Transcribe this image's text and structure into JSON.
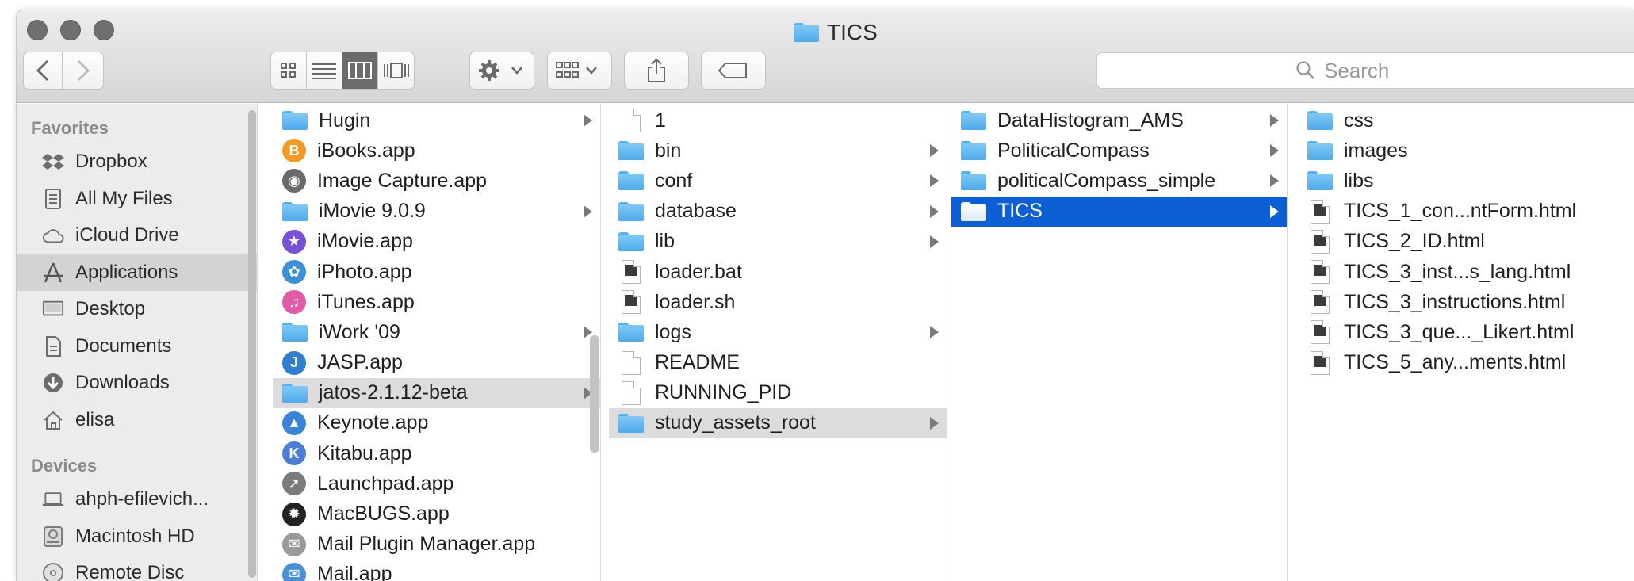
{
  "window": {
    "title": "TICS"
  },
  "toolbar": {
    "back_icon": "chevron-left-icon",
    "forward_icon": "chevron-right-icon",
    "view_icons": [
      "icon-view-icon",
      "list-view-icon",
      "column-view-icon",
      "cover-flow-icon"
    ],
    "action_icon": "gear-icon",
    "arrange_icon": "arrange-icon",
    "share_icon": "share-icon",
    "tag_icon": "tag-icon",
    "search_placeholder": "Search"
  },
  "sidebar": {
    "favorites_heading": "Favorites",
    "favorites": [
      {
        "label": "Dropbox",
        "icon": "dropbox-icon"
      },
      {
        "label": "All My Files",
        "icon": "all-files-icon"
      },
      {
        "label": "iCloud Drive",
        "icon": "cloud-icon"
      },
      {
        "label": "Applications",
        "icon": "applications-icon"
      },
      {
        "label": "Desktop",
        "icon": "desktop-icon"
      },
      {
        "label": "Documents",
        "icon": "documents-icon"
      },
      {
        "label": "Downloads",
        "icon": "downloads-icon"
      },
      {
        "label": "elisa",
        "icon": "home-icon"
      }
    ],
    "devices_heading": "Devices",
    "devices": [
      {
        "label": "ahph-efilevich...",
        "icon": "laptop-icon"
      },
      {
        "label": "Macintosh HD",
        "icon": "disk-icon"
      },
      {
        "label": "Remote Disc",
        "icon": "disc-icon"
      }
    ]
  },
  "columns": {
    "applications": [
      {
        "label": "Hugin",
        "icon": "folder",
        "chevron": true
      },
      {
        "label": "iBooks.app",
        "icon": "ibooks",
        "chevron": false
      },
      {
        "label": "Image Capture.app",
        "icon": "imagecapture",
        "chevron": false
      },
      {
        "label": "iMovie 9.0.9",
        "icon": "folder",
        "chevron": true
      },
      {
        "label": "iMovie.app",
        "icon": "imovie",
        "chevron": false
      },
      {
        "label": "iPhoto.app",
        "icon": "iphoto",
        "chevron": false
      },
      {
        "label": "iTunes.app",
        "icon": "itunes",
        "chevron": false
      },
      {
        "label": "iWork '09",
        "icon": "folder",
        "chevron": true
      },
      {
        "label": "JASP.app",
        "icon": "jasp",
        "chevron": false
      },
      {
        "label": "jatos-2.1.12-beta",
        "icon": "folder",
        "chevron": true
      },
      {
        "label": "Keynote.app",
        "icon": "keynote",
        "chevron": false
      },
      {
        "label": "Kitabu.app",
        "icon": "kitabu",
        "chevron": false
      },
      {
        "label": "Launchpad.app",
        "icon": "launchpad",
        "chevron": false
      },
      {
        "label": "MacBUGS.app",
        "icon": "macbugs",
        "chevron": false
      },
      {
        "label": "Mail Plugin Manager.app",
        "icon": "mailplugin",
        "chevron": false
      },
      {
        "label": "Mail.app",
        "icon": "mail",
        "chevron": false
      }
    ],
    "jatos": [
      {
        "label": "1",
        "icon": "doc",
        "chevron": false
      },
      {
        "label": "bin",
        "icon": "folder",
        "chevron": true
      },
      {
        "label": "conf",
        "icon": "folder",
        "chevron": true
      },
      {
        "label": "database",
        "icon": "folder",
        "chevron": true
      },
      {
        "label": "lib",
        "icon": "folder",
        "chevron": true
      },
      {
        "label": "loader.bat",
        "icon": "batch",
        "chevron": false
      },
      {
        "label": "loader.sh",
        "icon": "shell",
        "chevron": false
      },
      {
        "label": "logs",
        "icon": "folder",
        "chevron": true
      },
      {
        "label": "README",
        "icon": "doc",
        "chevron": false
      },
      {
        "label": "RUNNING_PID",
        "icon": "doc",
        "chevron": false
      },
      {
        "label": "study_assets_root",
        "icon": "folder",
        "chevron": true
      }
    ],
    "study_assets": [
      {
        "label": "DataHistogram_AMS",
        "icon": "folder",
        "chevron": true
      },
      {
        "label": "PoliticalCompass",
        "icon": "folder",
        "chevron": true
      },
      {
        "label": "politicalCompass_simple",
        "icon": "folder",
        "chevron": true
      },
      {
        "label": "TICS",
        "icon": "folder",
        "chevron": true
      }
    ],
    "tics": [
      {
        "label": "css",
        "icon": "folder",
        "chevron": true
      },
      {
        "label": "images",
        "icon": "folder",
        "chevron": true
      },
      {
        "label": "libs",
        "icon": "folder",
        "chevron": true
      },
      {
        "label": "TICS_1_con...ntForm.html",
        "icon": "html",
        "chevron": false
      },
      {
        "label": "TICS_2_ID.html",
        "icon": "html",
        "chevron": false
      },
      {
        "label": "TICS_3_inst...s_lang.html",
        "icon": "html",
        "chevron": false
      },
      {
        "label": "TICS_3_instructions.html",
        "icon": "html",
        "chevron": false
      },
      {
        "label": "TICS_3_que..._Likert.html",
        "icon": "html",
        "chevron": false
      },
      {
        "label": "TICS_5_any...ments.html",
        "icon": "html",
        "chevron": false
      }
    ]
  },
  "colors": {
    "selection_blue": "#0d5fd6",
    "selection_grey": "#dcdcdc",
    "folder_blue": "#5ab4ef"
  }
}
